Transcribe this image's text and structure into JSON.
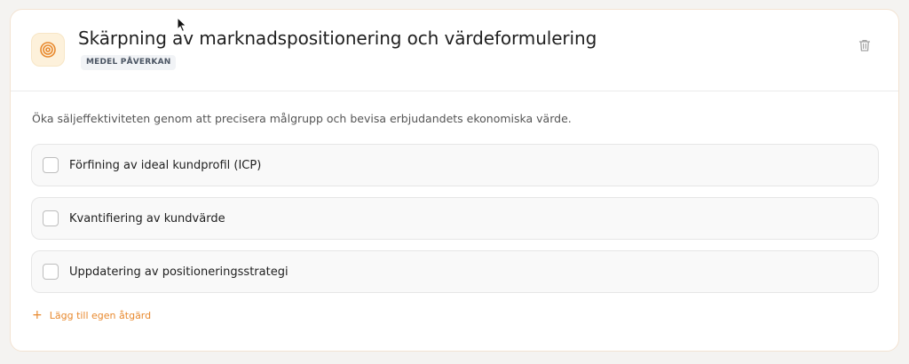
{
  "card": {
    "title": "Skärpning av marknadspositionering och värdeformulering",
    "impact_badge": "MEDEL PÅVERKAN",
    "header_icon": "target-icon",
    "delete_icon": "trash-icon",
    "description": "Öka säljeffektiviteten genom att precisera målgrupp och bevisa erbjudandets ekonomiska värde.",
    "actions": [
      {
        "label": "Förfining av ideal kundprofil (ICP)",
        "checked": false
      },
      {
        "label": "Kvantifiering av kundvärde",
        "checked": false
      },
      {
        "label": "Uppdatering av positioneringsstrategi",
        "checked": false
      }
    ],
    "add_action": {
      "icon": "plus-icon",
      "label": "Lägg till egen åtgärd"
    }
  },
  "colors": {
    "accent": "#e8892e",
    "icon_bg": "#fdf1db",
    "badge_bg": "#f1f3f6",
    "card_border": "#f3e3d2"
  }
}
